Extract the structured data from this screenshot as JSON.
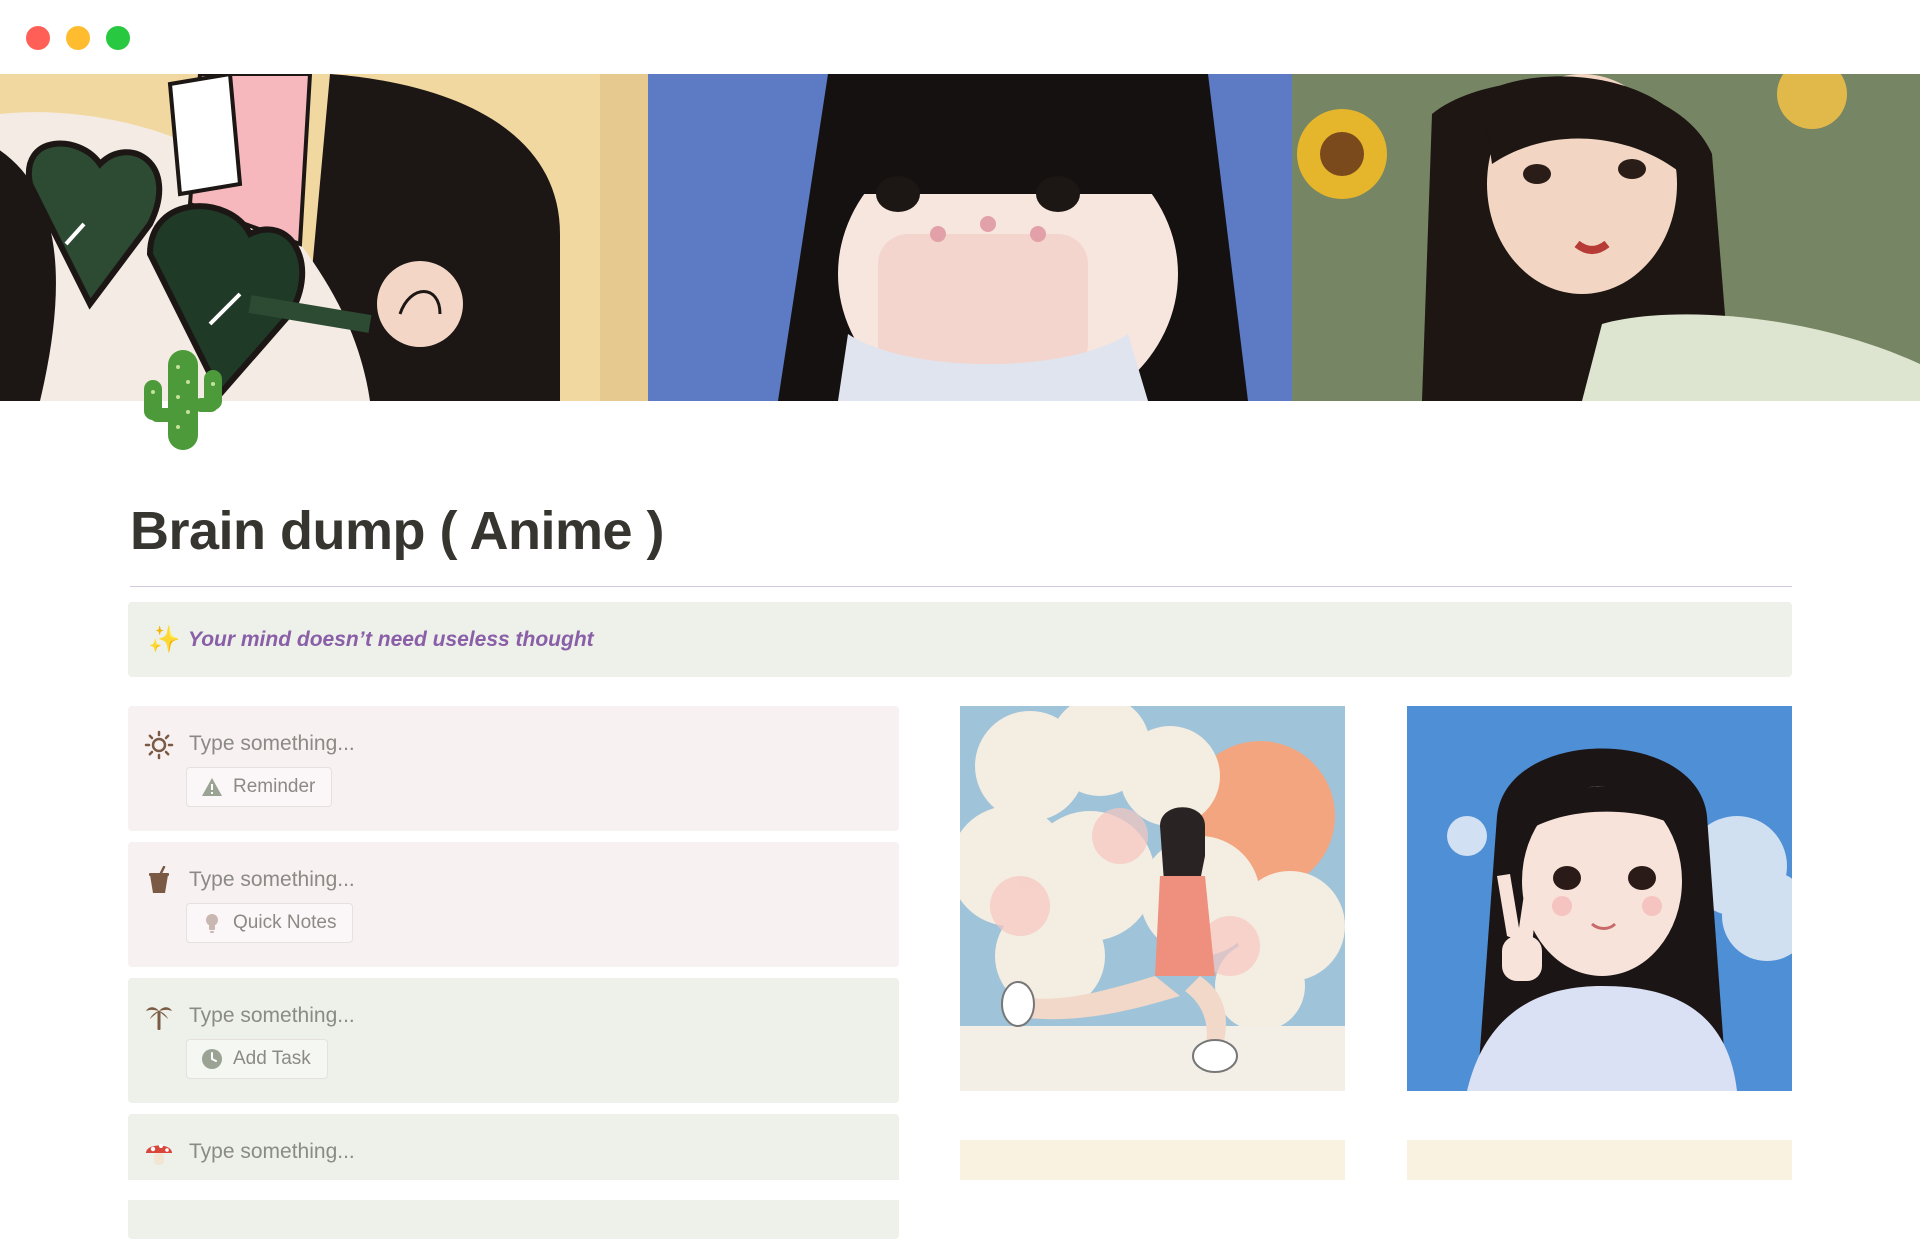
{
  "page": {
    "title": "Brain dump ( Anime )",
    "icon": "cactus-icon"
  },
  "cover": {
    "panels": [
      "anime-girl-heart-sunglasses",
      "anime-girl-hands-on-face",
      "anime-girl-sunflowers"
    ]
  },
  "callout": {
    "icon": "sparkles-icon",
    "text": "Your mind doesn’t need useless thought"
  },
  "cards": [
    {
      "icon": "sun-icon",
      "placeholder": "Type something...",
      "tag_icon": "warning-icon",
      "tag": "Reminder",
      "color": "#f7f1f2"
    },
    {
      "icon": "cup-icon",
      "placeholder": "Type something...",
      "tag_icon": "lightbulb-icon",
      "tag": "Quick Notes",
      "color": "#f7f1f2"
    },
    {
      "icon": "palm-tree-icon",
      "placeholder": "Type something...",
      "tag_icon": "clock-icon",
      "tag": "Add Task",
      "color": "#edf1ea"
    },
    {
      "icon": "mushroom-icon",
      "placeholder": "Type something...",
      "color": "#edf1ea"
    }
  ],
  "gallery": [
    {
      "name": "anime-girl-sitting-clouds"
    },
    {
      "name": "anime-girl-peace-sign"
    }
  ],
  "colors": {
    "accent_purple": "#8a5fa8",
    "callout_bg": "#edf1ea",
    "card_pink": "#f7f1f2",
    "cream": "#f9f2e0"
  }
}
